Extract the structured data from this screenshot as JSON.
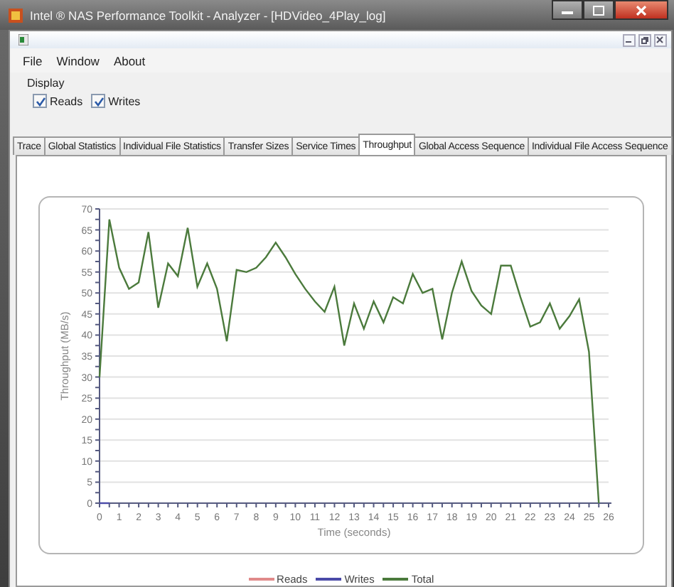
{
  "window": {
    "title": "Intel ® NAS Performance Toolkit - Analyzer - [HDVideo_4Play_log]"
  },
  "menu": [
    {
      "label": "File"
    },
    {
      "label": "Window"
    },
    {
      "label": "About"
    }
  ],
  "display": {
    "label": "Display",
    "options": [
      {
        "label": "Reads",
        "checked": true
      },
      {
        "label": "Writes",
        "checked": true
      }
    ]
  },
  "tabs": [
    {
      "label": "Trace",
      "selected": false
    },
    {
      "label": "Global Statistics",
      "selected": false
    },
    {
      "label": "Individual File Statistics",
      "selected": false
    },
    {
      "label": "Transfer Sizes",
      "selected": false
    },
    {
      "label": "Service Times",
      "selected": false
    },
    {
      "label": "Throughput",
      "selected": true
    },
    {
      "label": "Global Access Sequence",
      "selected": false
    },
    {
      "label": "Individual File Access Sequence",
      "selected": false
    }
  ],
  "throughput": {
    "chart_data": {
      "type": "line",
      "xlabel": "Time (seconds)",
      "ylabel": "Throughput (MB/s)",
      "x": [
        0,
        0.5,
        1,
        1.5,
        2,
        2.5,
        3,
        3.5,
        4,
        4.5,
        5,
        5.5,
        6,
        6.5,
        7,
        7.5,
        8,
        8.5,
        9,
        9.5,
        10,
        10.5,
        11,
        11.5,
        12,
        12.5,
        13,
        13.5,
        14,
        14.5,
        15,
        15.5,
        16,
        16.5,
        17,
        17.5,
        18,
        18.5,
        19,
        19.5,
        20,
        20.5,
        21,
        21.5,
        22,
        22.5,
        23,
        23.5,
        24,
        24.5,
        25,
        25.5
      ],
      "series": [
        {
          "name": "Reads",
          "color": "#e08a8a",
          "values": [
            null,
            null,
            null,
            null,
            null,
            null,
            null,
            null,
            null,
            null,
            null,
            null,
            null,
            null,
            null,
            null,
            null,
            null,
            null,
            null,
            null,
            null,
            null,
            null,
            null,
            null,
            null,
            null,
            null,
            null,
            null,
            null,
            null,
            null,
            null,
            null,
            null,
            null,
            null,
            null,
            null,
            null,
            null,
            null,
            null,
            null,
            null,
            null,
            null,
            null,
            null,
            null
          ]
        },
        {
          "name": "Writes",
          "color": "#4a4aa8",
          "values": [
            0,
            0,
            null,
            null,
            null,
            null,
            null,
            null,
            null,
            null,
            null,
            null,
            null,
            null,
            null,
            null,
            null,
            null,
            null,
            null,
            null,
            null,
            null,
            null,
            null,
            null,
            null,
            null,
            null,
            null,
            null,
            null,
            null,
            null,
            null,
            null,
            null,
            null,
            null,
            null,
            null,
            null,
            null,
            null,
            null,
            null,
            null,
            null,
            null,
            null,
            null,
            null
          ]
        },
        {
          "name": "Total",
          "color": "#4b7a3c",
          "values": [
            30,
            67.5,
            56,
            51,
            52.5,
            64.5,
            46.5,
            57,
            54,
            65.5,
            51.5,
            57,
            51,
            38.5,
            55.5,
            55,
            56,
            58.5,
            62,
            58.5,
            54.5,
            51,
            48,
            45.5,
            51.5,
            37.5,
            47.5,
            41.5,
            48,
            43,
            49,
            47.5,
            54.5,
            50,
            51,
            39,
            50,
            57.5,
            50.5,
            47,
            45,
            56.5,
            56.5,
            49,
            42,
            43,
            47.5,
            41.5,
            44.5,
            48.5,
            36,
            0
          ]
        }
      ],
      "grid": true,
      "xlim": [
        0,
        26
      ],
      "ylim": [
        0,
        70
      ],
      "xticks": [
        0,
        1,
        2,
        3,
        4,
        5,
        6,
        7,
        8,
        9,
        10,
        11,
        12,
        13,
        14,
        15,
        16,
        17,
        18,
        19,
        20,
        21,
        22,
        23,
        24,
        25,
        26
      ],
      "yticks": [
        0,
        5,
        10,
        15,
        20,
        25,
        30,
        35,
        40,
        45,
        50,
        55,
        60,
        65,
        70
      ]
    }
  }
}
